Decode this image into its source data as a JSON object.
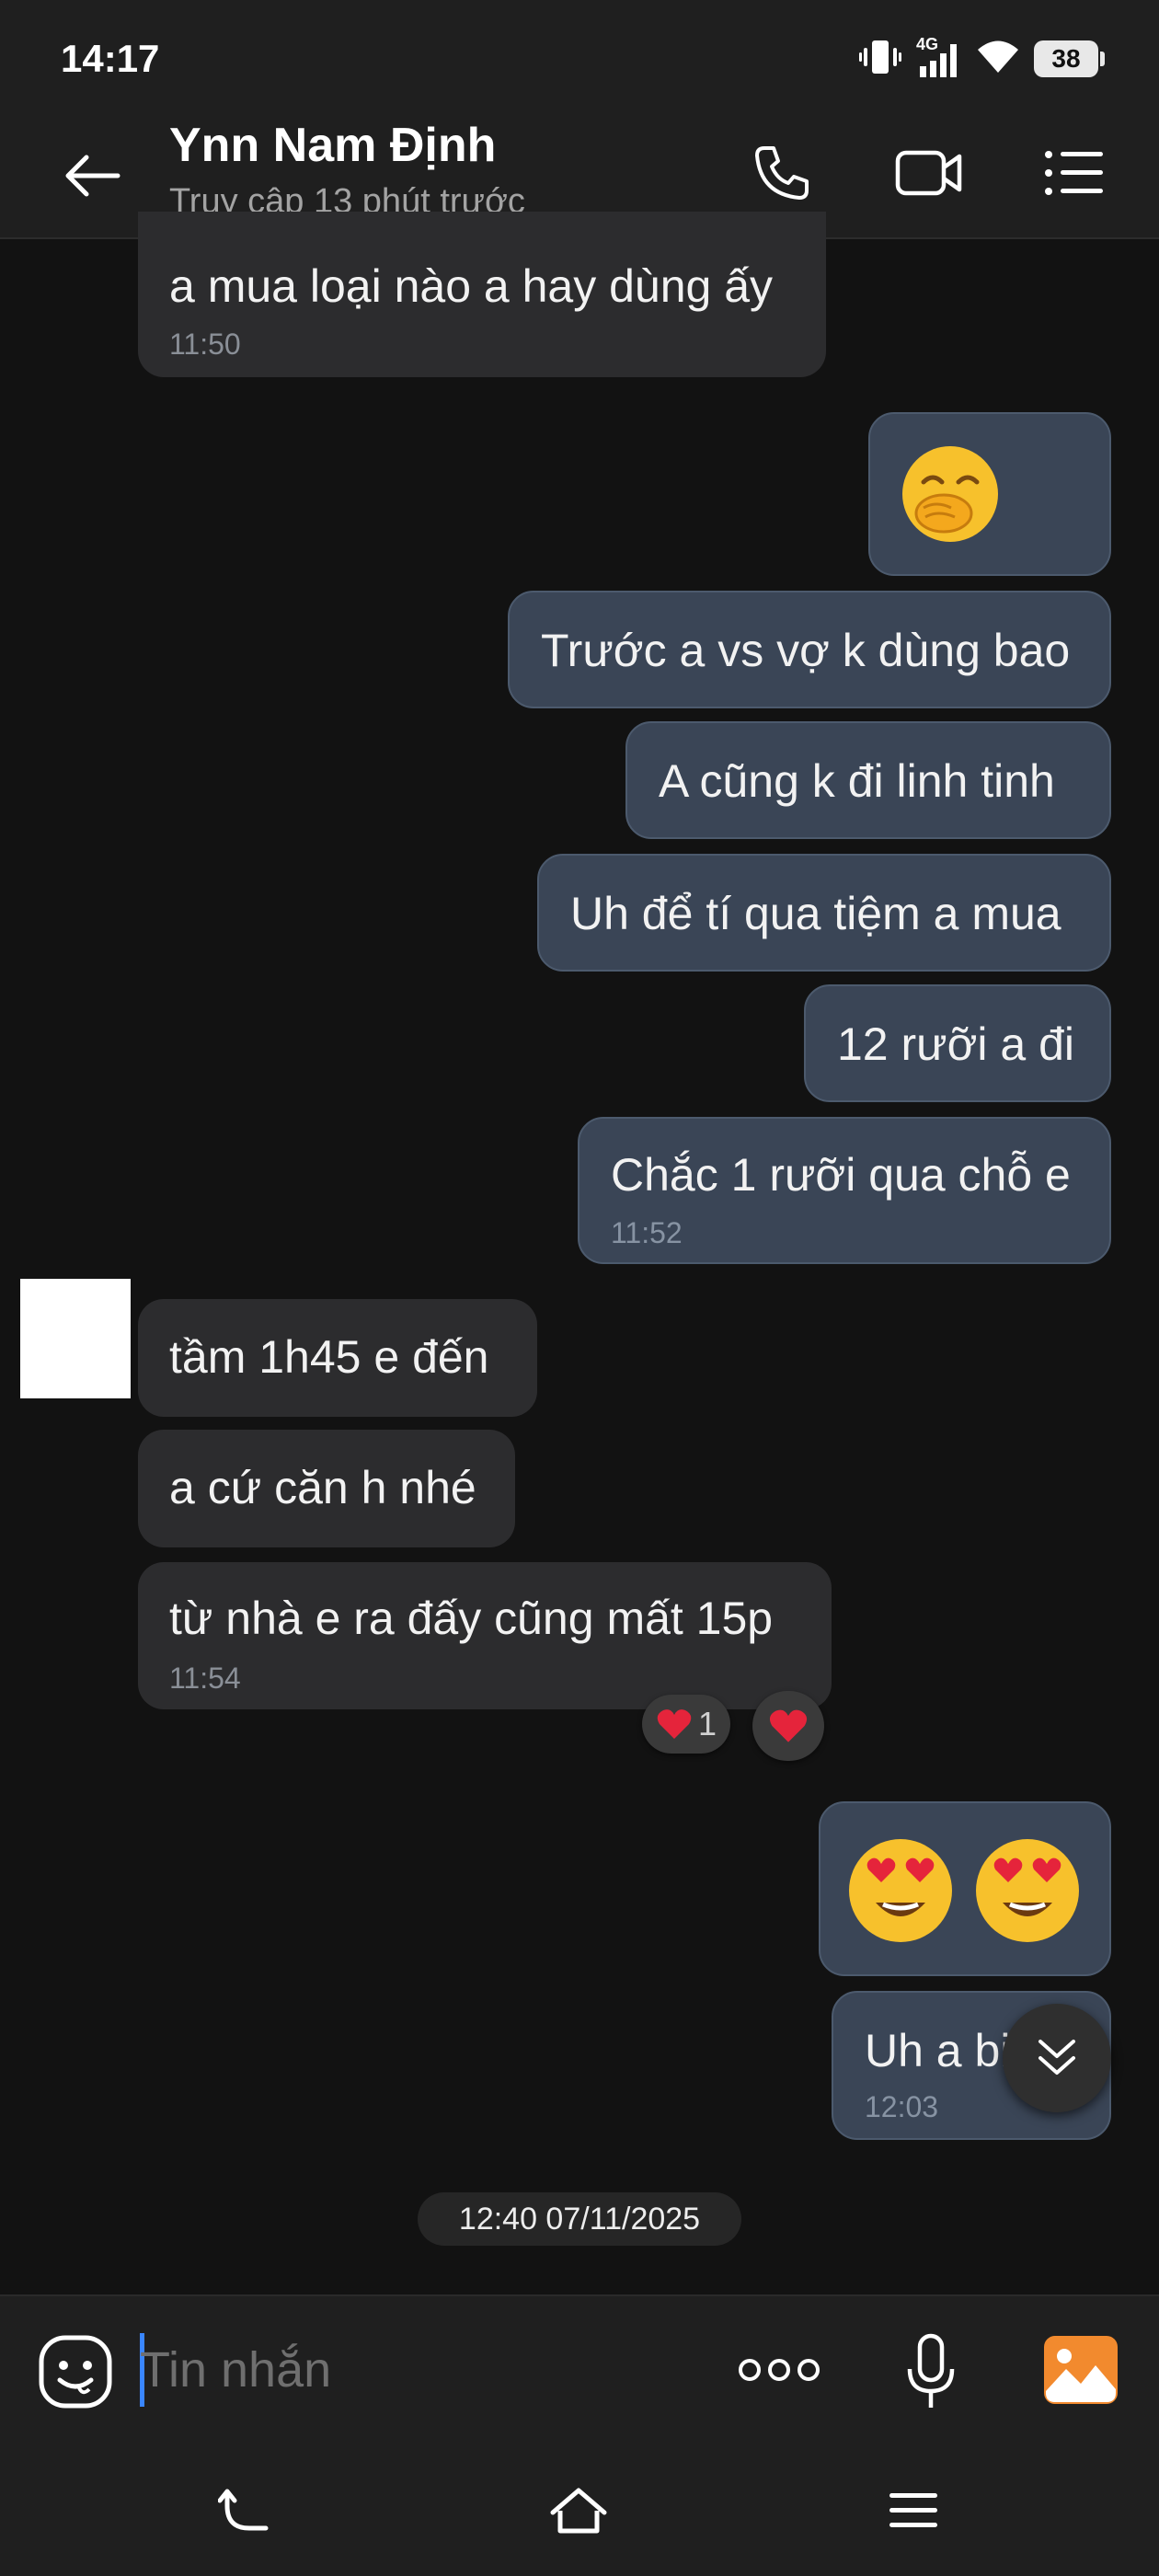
{
  "status_bar": {
    "time": "14:17",
    "network": "4G",
    "battery": "38"
  },
  "header": {
    "contact_name": "Ynn Nam Định",
    "contact_status": "Truy cập 13 phút trước"
  },
  "messages": [
    {
      "direction": "in",
      "text": "a mua loại nào a hay dùng ấy",
      "time": "11:50"
    },
    {
      "direction": "out",
      "emoji": "hand-over-mouth-emoji"
    },
    {
      "direction": "out",
      "text": "Trước a vs vợ k dùng bao"
    },
    {
      "direction": "out",
      "text": "A cũng k đi linh tinh"
    },
    {
      "direction": "out",
      "text": "Uh để tí qua tiệm a mua"
    },
    {
      "direction": "out",
      "text": "12 rưỡi a đi"
    },
    {
      "direction": "out",
      "text": "Chắc 1 rưỡi qua chỗ e",
      "time": "11:52"
    },
    {
      "direction": "in",
      "text": "tầm 1h45 e đến"
    },
    {
      "direction": "in",
      "text": "a cứ căn h nhé"
    },
    {
      "direction": "in",
      "text": "từ nhà e ra đấy cũng mất 15p",
      "time": "11:54",
      "reaction_count": "1"
    },
    {
      "direction": "out",
      "emoji": "heart-eyes-emoji"
    },
    {
      "direction": "out",
      "text": "Uh a bi",
      "time": "12:03"
    }
  ],
  "date_separator": "12:40 07/11/2025",
  "composer": {
    "placeholder": "Tin nhắn"
  },
  "colors": {
    "background": "#121212",
    "incoming_bubble": "#2c2c2e",
    "outgoing_bubble": "#3a4556",
    "accent_caret": "#3a86ff",
    "gallery_icon": "#f28a2e",
    "heart": "#e5243b"
  }
}
